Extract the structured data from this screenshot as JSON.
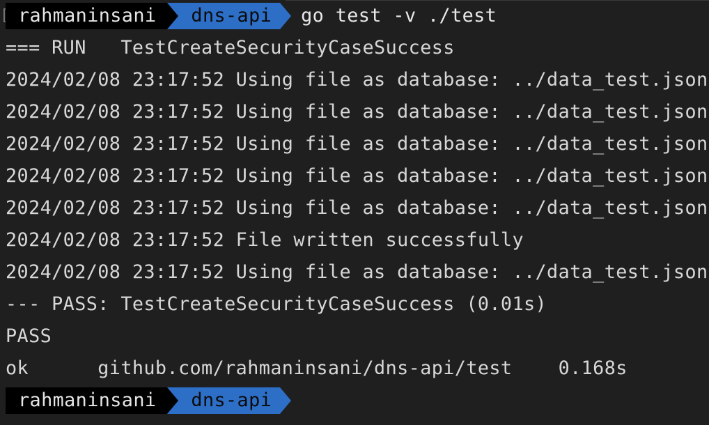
{
  "prompt_top": {
    "user": "rahmaninsani",
    "dir": "dns-api",
    "command": "go test -v ./test"
  },
  "edge_char": "[",
  "output_lines": [
    "=== RUN   TestCreateSecurityCaseSuccess",
    "2024/02/08 23:17:52 Using file as database: ../data_test.json",
    "2024/02/08 23:17:52 Using file as database: ../data_test.json",
    "2024/02/08 23:17:52 Using file as database: ../data_test.json",
    "2024/02/08 23:17:52 Using file as database: ../data_test.json",
    "2024/02/08 23:17:52 Using file as database: ../data_test.json",
    "2024/02/08 23:17:52 File written successfully",
    "2024/02/08 23:17:52 Using file as database: ../data_test.json",
    "--- PASS: TestCreateSecurityCaseSuccess (0.01s)",
    "PASS",
    "ok      github.com/rahmaninsani/dns-api/test    0.168s"
  ],
  "prompt_bottom": {
    "user": "rahmaninsani",
    "dir": "dns-api"
  },
  "colors": {
    "background": "#1f1f1f",
    "text": "#d7d7d7",
    "user_segment_bg": "#000000",
    "dir_segment_bg": "#2d6fc7"
  }
}
